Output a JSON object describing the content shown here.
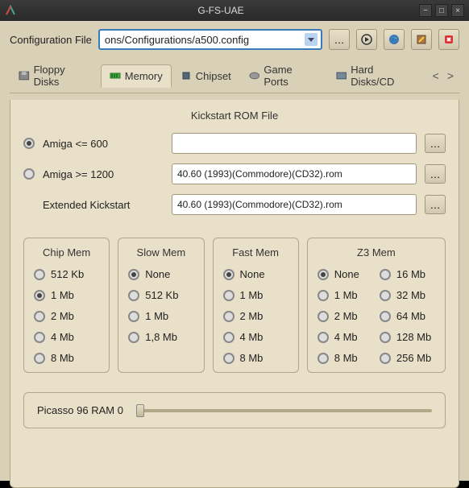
{
  "window": {
    "title": "G-FS-UAE"
  },
  "config": {
    "label": "Configuration File",
    "value": "ons/Configurations/a500.config"
  },
  "tabs": {
    "floppy": "Floppy Disks",
    "memory": "Memory",
    "chipset": "Chipset",
    "gameports": "Game Ports",
    "harddisks": "Hard Disks/CD"
  },
  "kickstart": {
    "title": "Kickstart ROM File",
    "row1_label": "Amiga <= 600",
    "row1_value": "",
    "row2_label": "Amiga >= 1200",
    "row2_value": "40.60 (1993)(Commodore)(CD32).rom",
    "row3_label": "Extended Kickstart",
    "row3_value": "40.60 (1993)(Commodore)(CD32).rom"
  },
  "mem": {
    "chip": {
      "title": "Chip Mem",
      "opts": [
        "512 Kb",
        "1 Mb",
        "2 Mb",
        "4 Mb",
        "8 Mb"
      ],
      "sel": 1
    },
    "slow": {
      "title": "Slow Mem",
      "opts": [
        "None",
        "512 Kb",
        "1 Mb",
        "1,8 Mb"
      ],
      "sel": 0
    },
    "fast": {
      "title": "Fast Mem",
      "opts": [
        "None",
        "1 Mb",
        "2 Mb",
        "4 Mb",
        "8 Mb"
      ],
      "sel": 0
    },
    "z3": {
      "title": "Z3 Mem",
      "opts": [
        "None",
        "16 Mb",
        "1 Mb",
        "32 Mb",
        "2 Mb",
        "64 Mb",
        "4 Mb",
        "128 Mb",
        "8 Mb",
        "256 Mb"
      ],
      "sel": 0
    }
  },
  "picasso": {
    "label": "Picasso 96 RAM 0"
  }
}
